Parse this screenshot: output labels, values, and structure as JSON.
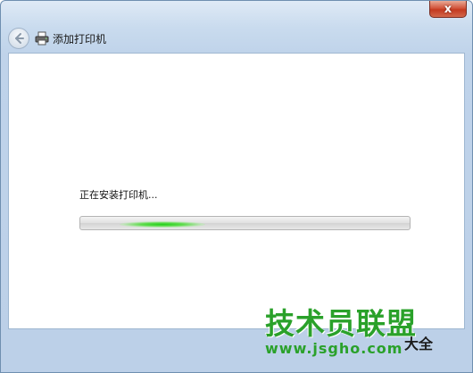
{
  "window": {
    "title": "添加打印机",
    "close_label": "x"
  },
  "main": {
    "status_text": "正在安装打印机...",
    "progress": {
      "style": "marquee",
      "glow_position_fraction": 0.12
    }
  },
  "watermark": {
    "brand": "技术员联盟",
    "url": "www.jsgho.com",
    "tag": "大全"
  },
  "colors": {
    "progress_glow": "#22cf1a",
    "close_button": "#c43a20",
    "watermark": "#2aa12a"
  },
  "icons": {
    "back": "back-arrow-icon",
    "printer": "printer-icon",
    "close": "close-icon"
  }
}
